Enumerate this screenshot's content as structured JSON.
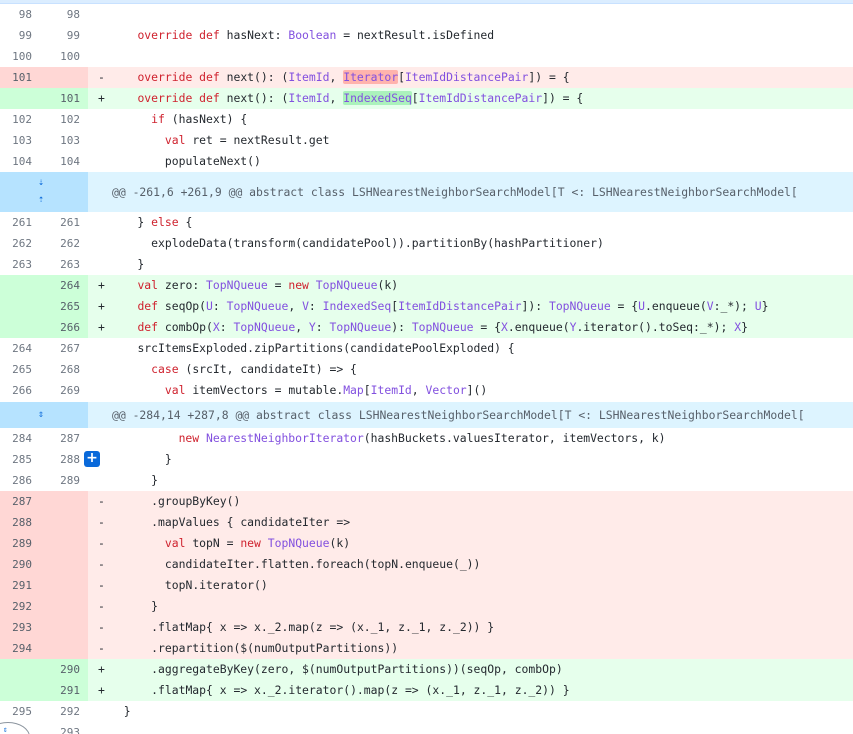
{
  "hunks": [
    {
      "header": "@@ -261,6 +261,9 @@ abstract class LSHNearestNeighborSearchModel[T <: LSHNearestNeighborSearchModel["
    },
    {
      "header": "@@ -284,14 +287,8 @@ abstract class LSHNearestNeighborSearchModel[T <: LSHNearestNeighborSearchModel["
    }
  ],
  "lines": [
    {
      "type": "ctx",
      "old": "98",
      "new": "98",
      "sign": "",
      "code": ""
    },
    {
      "type": "ctx",
      "old": "99",
      "new": "99",
      "sign": "",
      "code": "    override def hasNext: Boolean = nextResult.isDefined"
    },
    {
      "type": "ctx",
      "old": "100",
      "new": "100",
      "sign": "",
      "code": ""
    },
    {
      "type": "del",
      "old": "101",
      "new": "",
      "sign": "-",
      "code": "    override def next(): (ItemId, Iterator[ItemIdDistancePair]) = {"
    },
    {
      "type": "add",
      "old": "",
      "new": "101",
      "sign": "+",
      "code": "    override def next(): (ItemId, IndexedSeq[ItemIdDistancePair]) = {"
    },
    {
      "type": "ctx",
      "old": "102",
      "new": "102",
      "sign": "",
      "code": "      if (hasNext) {"
    },
    {
      "type": "ctx",
      "old": "103",
      "new": "103",
      "sign": "",
      "code": "        val ret = nextResult.get"
    },
    {
      "type": "ctx",
      "old": "104",
      "new": "104",
      "sign": "",
      "code": "        populateNext()"
    },
    {
      "type": "ctx",
      "old": "261",
      "new": "261",
      "sign": "",
      "code": "    } else {"
    },
    {
      "type": "ctx",
      "old": "262",
      "new": "262",
      "sign": "",
      "code": "      explodeData(transform(candidatePool)).partitionBy(hashPartitioner)"
    },
    {
      "type": "ctx",
      "old": "263",
      "new": "263",
      "sign": "",
      "code": "    }"
    },
    {
      "type": "add",
      "old": "",
      "new": "264",
      "sign": "+",
      "code": "    val zero: TopNQueue = new TopNQueue(k)"
    },
    {
      "type": "add",
      "old": "",
      "new": "265",
      "sign": "+",
      "code": "    def seqOp(U: TopNQueue, V: IndexedSeq[ItemIdDistancePair]): TopNQueue = {U.enqueue(V:_*); U}"
    },
    {
      "type": "add",
      "old": "",
      "new": "266",
      "sign": "+",
      "code": "    def combOp(X: TopNQueue, Y: TopNQueue): TopNQueue = {X.enqueue(Y.iterator().toSeq:_*); X}"
    },
    {
      "type": "ctx",
      "old": "264",
      "new": "267",
      "sign": "",
      "code": "    srcItemsExploded.zipPartitions(candidatePoolExploded) {"
    },
    {
      "type": "ctx",
      "old": "265",
      "new": "268",
      "sign": "",
      "code": "      case (srcIt, candidateIt) => {"
    },
    {
      "type": "ctx",
      "old": "266",
      "new": "269",
      "sign": "",
      "code": "        val itemVectors = mutable.Map[ItemId, Vector]()"
    },
    {
      "type": "ctx",
      "old": "284",
      "new": "287",
      "sign": "",
      "code": "          new NearestNeighborIterator(hashBuckets.valuesIterator, itemVectors, k)"
    },
    {
      "type": "ctx",
      "old": "285",
      "new": "288",
      "sign": "",
      "code": "        }"
    },
    {
      "type": "ctx",
      "old": "286",
      "new": "289",
      "sign": "",
      "code": "      }"
    },
    {
      "type": "del",
      "old": "287",
      "new": "",
      "sign": "-",
      "code": "      .groupByKey()"
    },
    {
      "type": "del",
      "old": "288",
      "new": "",
      "sign": "-",
      "code": "      .mapValues { candidateIter =>"
    },
    {
      "type": "del",
      "old": "289",
      "new": "",
      "sign": "-",
      "code": "        val topN = new TopNQueue(k)"
    },
    {
      "type": "del",
      "old": "290",
      "new": "",
      "sign": "-",
      "code": "        candidateIter.flatten.foreach(topN.enqueue(_))"
    },
    {
      "type": "del",
      "old": "291",
      "new": "",
      "sign": "-",
      "code": "        topN.iterator()"
    },
    {
      "type": "del",
      "old": "292",
      "new": "",
      "sign": "-",
      "code": "      }"
    },
    {
      "type": "del",
      "old": "293",
      "new": "",
      "sign": "-",
      "code": "      .flatMap{ x => x._2.map(z => (x._1, z._1, z._2)) }"
    },
    {
      "type": "del",
      "old": "294",
      "new": "",
      "sign": "-",
      "code": "      .repartition($(numOutputPartitions))"
    },
    {
      "type": "add",
      "old": "",
      "new": "290",
      "sign": "+",
      "code": "      .aggregateByKey(zero, $(numOutputPartitions))(seqOp, combOp)"
    },
    {
      "type": "add",
      "old": "",
      "new": "291",
      "sign": "+",
      "code": "      .flatMap{ x => x._2.iterator().map(z => (x._1, z._1, z._2)) }"
    },
    {
      "type": "ctx",
      "old": "295",
      "new": "292",
      "sign": "",
      "code": "  }"
    },
    {
      "type": "ctx",
      "old": "",
      "new": "293",
      "sign": "",
      "code": ""
    }
  ],
  "add_comment_button": "+",
  "icons": {
    "expand": "expand-icon",
    "add_comment": "plus-icon"
  },
  "colors": {
    "deletion_bg": "#ffebe9",
    "deletion_gutter": "#ffd7d5",
    "addition_bg": "#e6ffec",
    "addition_gutter": "#ccffd8",
    "hunk_bg": "#ddf4ff",
    "hunk_gutter": "#b6e3ff",
    "accent": "#0969da"
  }
}
